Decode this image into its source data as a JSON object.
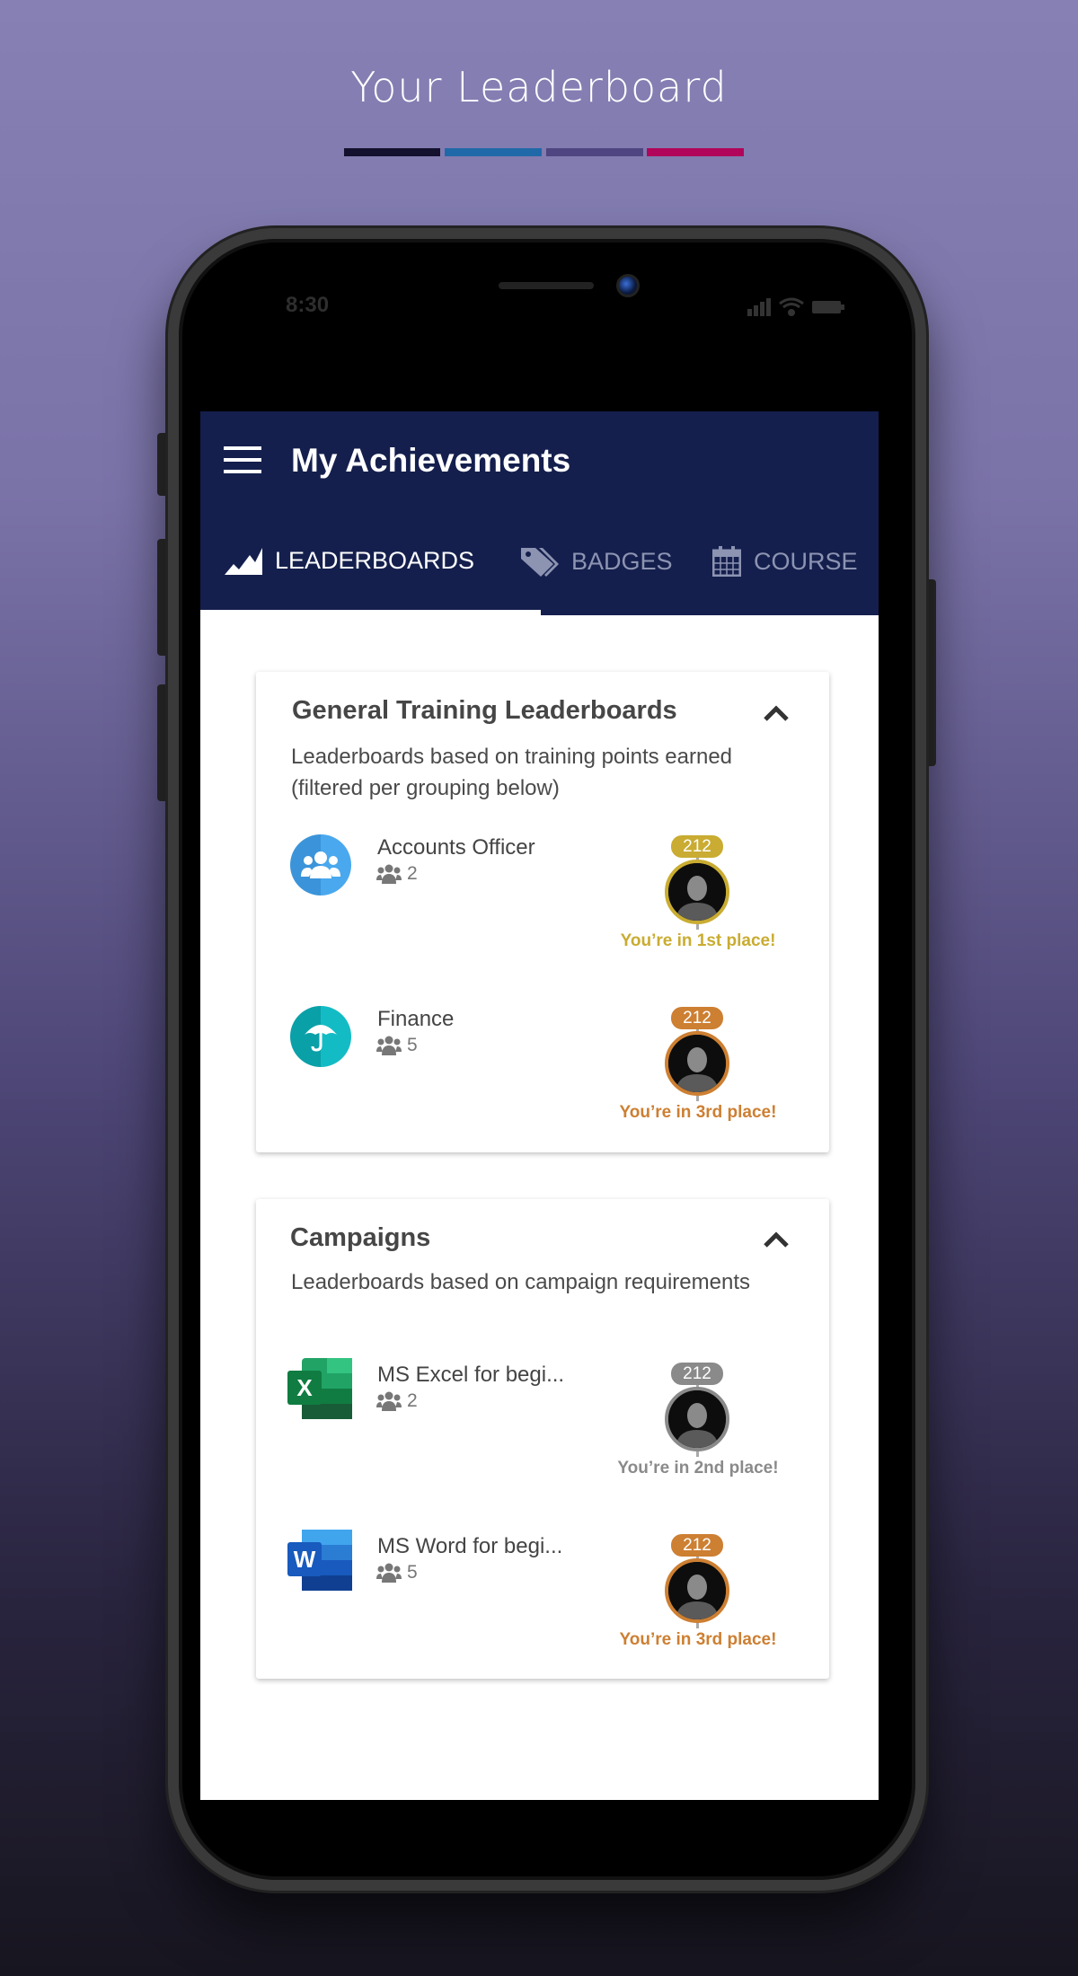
{
  "hero": {
    "title": "Your Leaderboard",
    "bar_colors": [
      "#13112e",
      "#2069a8",
      "#4f4681",
      "#b0055a"
    ]
  },
  "status_bar": {
    "time": "8:30"
  },
  "app": {
    "title": "My Achievements",
    "header_color": "#141f4d",
    "tabs": [
      {
        "label": "LEADERBOARDS",
        "icon": "chart-area-icon",
        "active": true
      },
      {
        "label": "BADGES",
        "icon": "tags-icon",
        "active": false
      },
      {
        "label": "COURSE",
        "icon": "calendar-icon",
        "active": false
      }
    ]
  },
  "sections": [
    {
      "title": "General Training Leaderboards",
      "subtitle": [
        "Leaderboards based on training points earned",
        "(filtered per grouping below)"
      ],
      "items": [
        {
          "name": "Accounts Officer",
          "members": "2",
          "icon": "users-icon",
          "score": "212",
          "place": "You’re in 1st place!",
          "color": "#c9ac31"
        },
        {
          "name": "Finance",
          "members": "5",
          "icon": "umbrella-icon",
          "score": "212",
          "place": "You’re in 3rd place!",
          "color": "#cd7f32"
        }
      ]
    },
    {
      "title": "Campaigns",
      "subtitle": [
        "Leaderboards based on campaign requirements"
      ],
      "items": [
        {
          "name": "MS Excel for begi...",
          "members": "2",
          "icon": "excel-icon",
          "score": "212",
          "place": "You’re in 2nd place!",
          "color": "#8a8a8a"
        },
        {
          "name": "MS Word for begi...",
          "members": "5",
          "icon": "word-icon",
          "score": "212",
          "place": "You’re in 3rd place!",
          "color": "#cd7f32"
        }
      ]
    }
  ]
}
